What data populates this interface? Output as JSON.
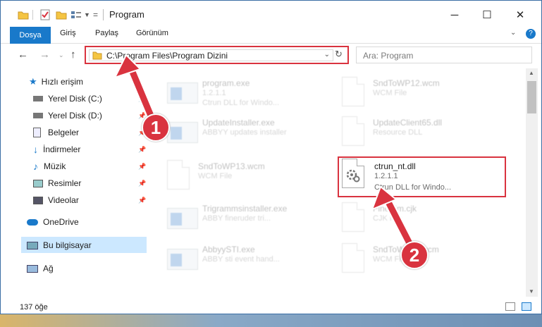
{
  "window": {
    "title": "Program",
    "controls": {
      "minimize": "─",
      "maximize": "☐",
      "close": "✕"
    }
  },
  "ribbon": {
    "tabs": [
      "Dosya",
      "Giriş",
      "Paylaş",
      "Görünüm"
    ]
  },
  "address": {
    "path": "C:\\Program Files\\Program Dizini"
  },
  "search": {
    "placeholder": "Ara: Program"
  },
  "nav": {
    "items": [
      {
        "label": "Hızlı erişim",
        "icon": "star-icon"
      },
      {
        "label": "Yerel Disk (C:)",
        "icon": "drive-icon"
      },
      {
        "label": "Yerel Disk (D:)",
        "icon": "drive-icon"
      },
      {
        "label": "Belgeler",
        "icon": "documents-icon"
      },
      {
        "label": "İndirmeler",
        "icon": "download-icon"
      },
      {
        "label": "Müzik",
        "icon": "music-icon"
      },
      {
        "label": "Resimler",
        "icon": "pictures-icon"
      },
      {
        "label": "Videolar",
        "icon": "videos-icon"
      },
      {
        "label": "OneDrive",
        "icon": "cloud-icon"
      },
      {
        "label": "Bu bilgisayar",
        "icon": "computer-icon"
      },
      {
        "label": "Ağ",
        "icon": "network-icon"
      }
    ]
  },
  "files": [
    {
      "name": "program.exe",
      "line2": "1.2.1.1",
      "line3": "Ctrun DLL for Windo...",
      "icon": "exe-icon"
    },
    {
      "name": "SndToWP12.wcm",
      "line2": "WCM File",
      "line3": "",
      "icon": "document-icon"
    },
    {
      "name": "UpdateInstaller.exe",
      "line2": "ABBYY updates installer",
      "line3": "",
      "icon": "app-icon"
    },
    {
      "name": "UpdateClient65.dll",
      "line2": "Resource DLL",
      "line3": "",
      "icon": "dll-icon"
    },
    {
      "name": "SndToWP13.wcm",
      "line2": "WCM File",
      "line3": "",
      "icon": "document-icon"
    },
    {
      "name": "ctrun_nt.dll",
      "line2": "1.2.1.1",
      "line3": "Ctrun DLL for Windo...",
      "icon": "dll-icon"
    },
    {
      "name": "Trigrammsinstaller.exe",
      "line2": "ABBY fineruder tri...",
      "line3": "",
      "icon": "app-icon"
    },
    {
      "name": "FineSim.cjk",
      "line2": "CJK File",
      "line3": "",
      "icon": "document-icon"
    },
    {
      "name": "AbbyySTI.exe",
      "line2": "ABBY sti event hand...",
      "line3": "",
      "icon": "app-icon"
    },
    {
      "name": "SndToWP11.wcm",
      "line2": "WCM File",
      "line3": "",
      "icon": "document-icon"
    }
  ],
  "status": {
    "count": "137 öğe"
  },
  "annotations": {
    "badge1": "1",
    "badge2": "2"
  },
  "colors": {
    "accent": "#1979ca",
    "highlight": "#d9333f",
    "selection": "#cce8ff"
  }
}
